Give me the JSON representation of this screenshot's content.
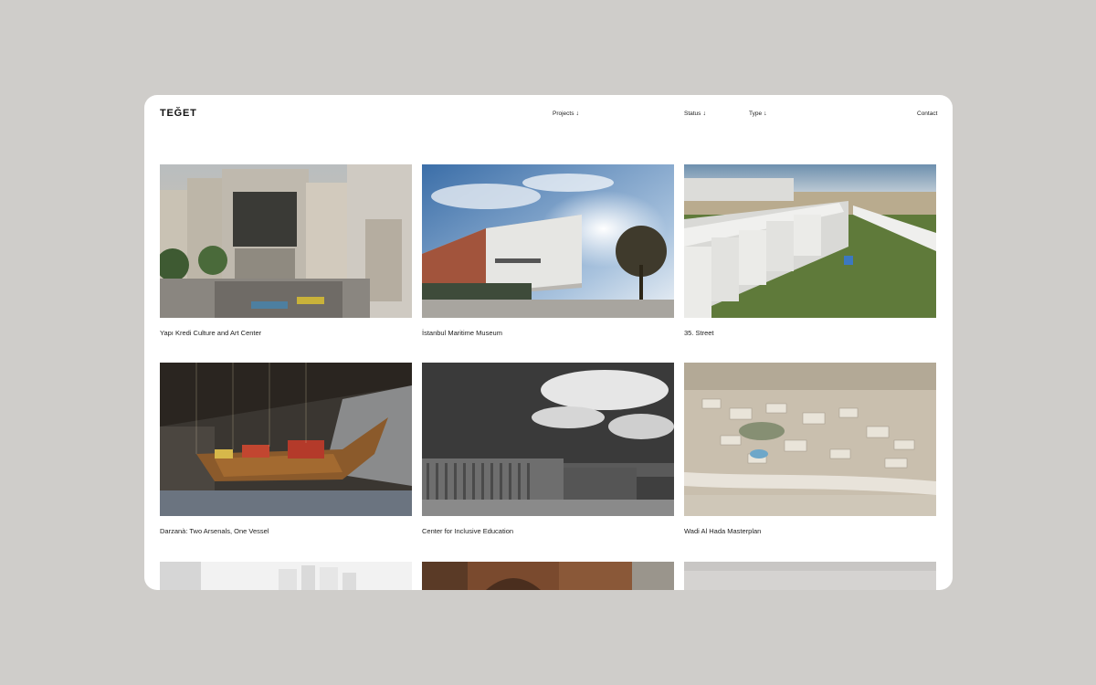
{
  "brand": {
    "logo_text": "TEĞET"
  },
  "nav": {
    "projects": "Projects",
    "status": "Status",
    "type": "Type",
    "contact": "Contact",
    "arrow": "↓"
  },
  "projects": [
    {
      "title": "Yapı Kredi Culture and Art Center"
    },
    {
      "title": "İstanbul Maritime Museum"
    },
    {
      "title": "35. Street"
    },
    {
      "title": "Darzanà: Two Arsenals, One Vessel"
    },
    {
      "title": "Center for Inclusive Education"
    },
    {
      "title": "Wadi Al Hada Masterplan"
    }
  ],
  "colors": {
    "page_background": "#cfcdca",
    "window_background": "#ffffff",
    "text": "#1a1a1a"
  }
}
